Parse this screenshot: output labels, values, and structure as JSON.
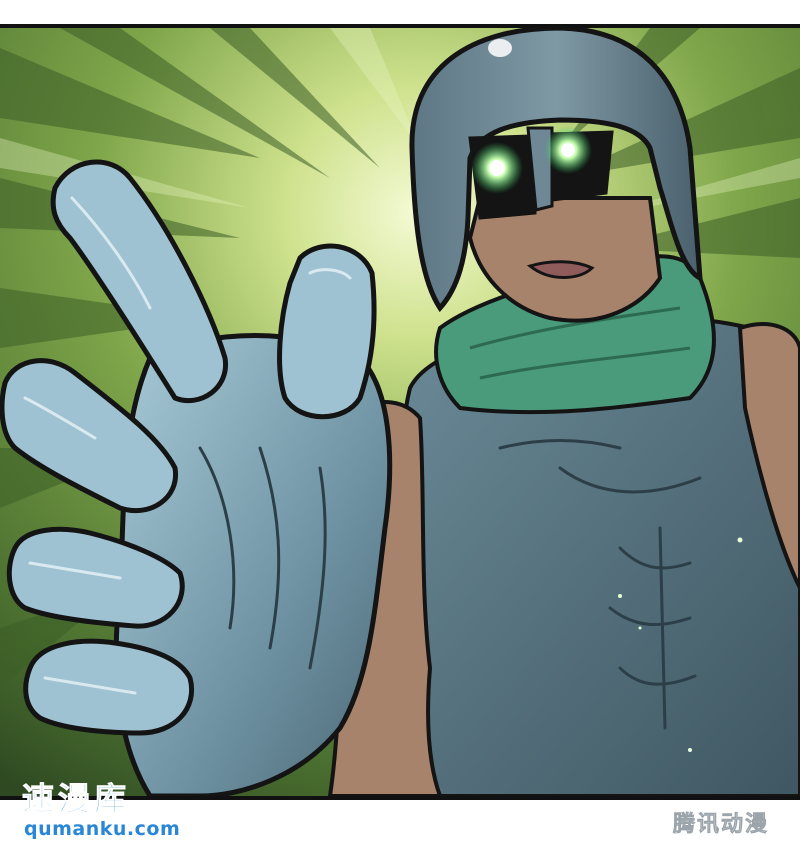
{
  "image": {
    "description_colors": {
      "background_light": "#eef6c8",
      "background_green": "#6f9a3c",
      "background_dark": "#2f4a22",
      "armor": "#4f6b78",
      "armor_light": "#8fb3c4",
      "scarf": "#4a9a7c",
      "skin": "#a8836c",
      "eye_glow": "#b8ff9a",
      "ink": "#141414"
    }
  },
  "watermarks": {
    "left": {
      "chinese_text": "速漫库",
      "url": "qumanku.com",
      "color": "#2a86d6"
    },
    "right": {
      "chinese_text": "腾讯动漫",
      "color": "#ffffff"
    }
  }
}
